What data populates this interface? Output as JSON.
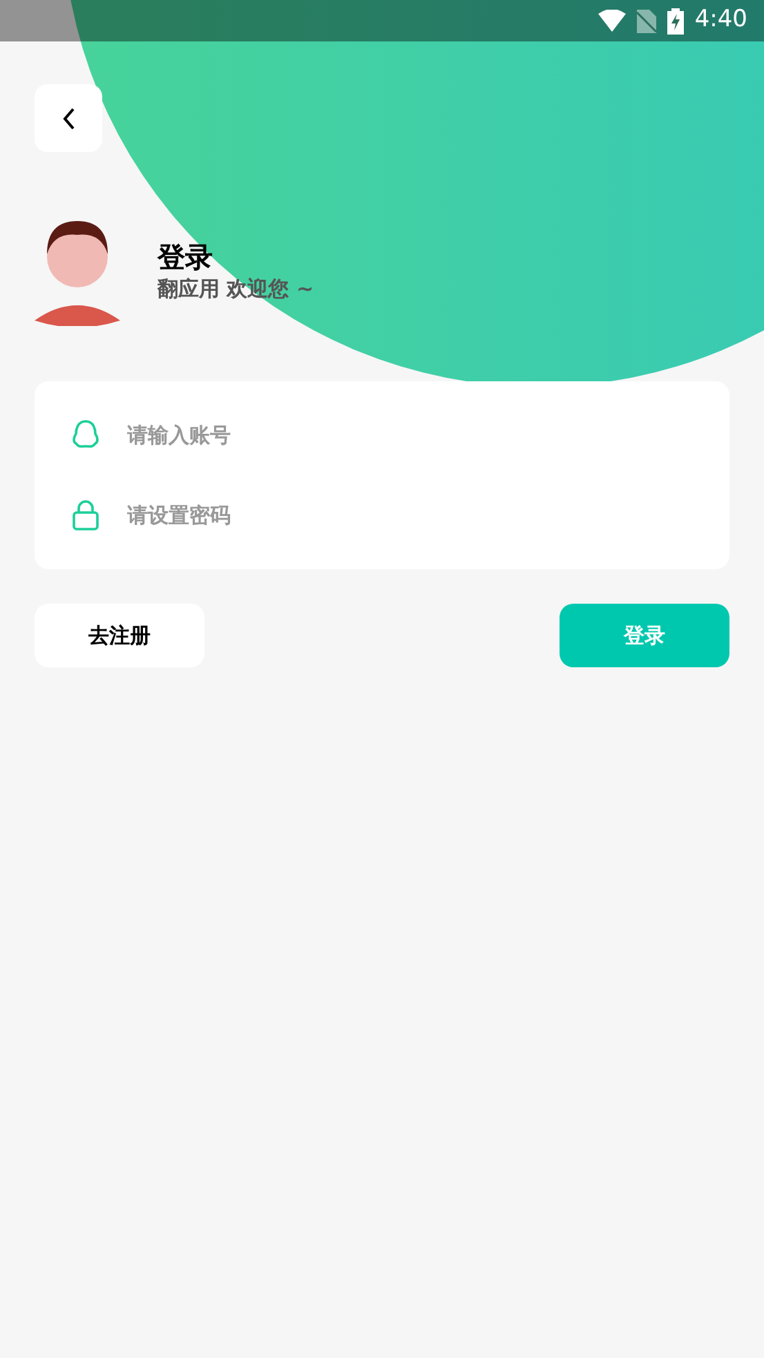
{
  "status_bar": {
    "time": "4:40"
  },
  "header": {
    "title": "登录",
    "subtitle": "翻应用 欢迎您 ~"
  },
  "form": {
    "fields": [
      {
        "kind": "account",
        "placeholder": "请输入账号"
      },
      {
        "kind": "password",
        "placeholder": "请设置密码"
      }
    ]
  },
  "buttons": [
    {
      "kind": "secondary",
      "label": "去注册"
    },
    {
      "kind": "primary",
      "label": "登录"
    }
  ]
}
